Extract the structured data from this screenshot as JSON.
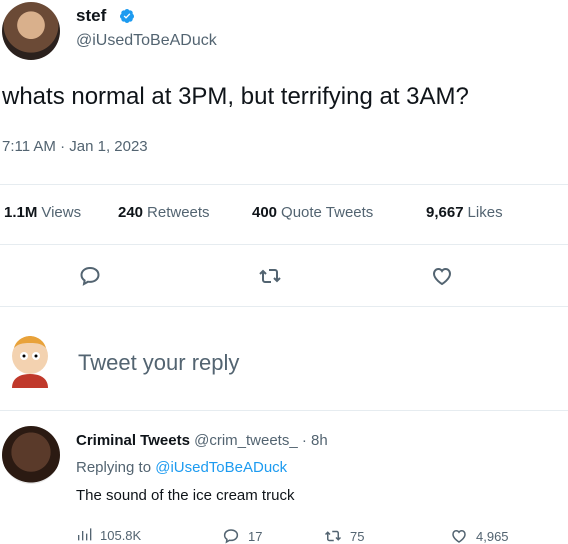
{
  "tweet": {
    "author_name": "stef",
    "author_handle": "@iUsedToBeADuck",
    "text": "whats normal at 3PM, but terrifying at 3AM?",
    "timestamp": "7:11 AM · Jan 1, 2023",
    "verified": true
  },
  "stats": {
    "views_count": "1.1M",
    "views_label": "Views",
    "retweets_count": "240",
    "retweets_label": "Retweets",
    "quotes_count": "400",
    "quotes_label": "Quote Tweets",
    "likes_count": "9,667",
    "likes_label": "Likes"
  },
  "actions": {
    "reply_icon": "comment-icon",
    "retweet_icon": "retweet-icon",
    "like_icon": "heart-icon"
  },
  "composer": {
    "placeholder": "Tweet your reply"
  },
  "reply": {
    "name": "Criminal Tweets",
    "handle": "@crim_tweets_",
    "time": "· 8h",
    "replying_to_label": "Replying to",
    "replying_to_handle": "@iUsedToBeADuck",
    "text": "The sound of the ice cream truck",
    "views": "105.8K",
    "replies": "17",
    "retweets": "75",
    "likes": "4,965"
  },
  "colors": {
    "accent": "#1d9bf0",
    "text": "#0f1419",
    "muted": "#536471",
    "divider": "#e6ecf0"
  }
}
